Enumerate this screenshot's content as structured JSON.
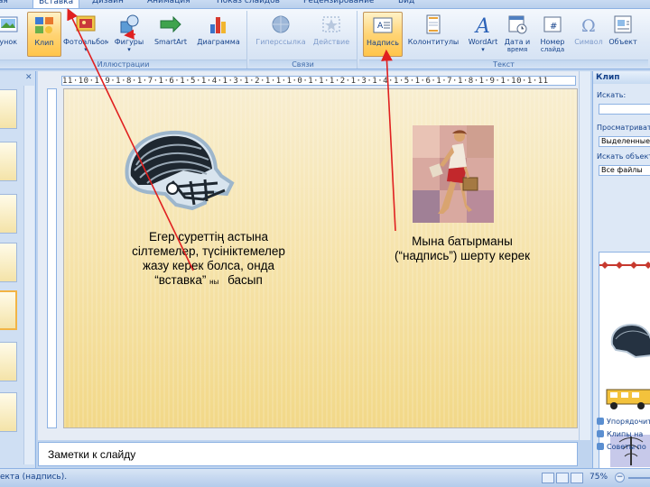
{
  "tabs": [
    {
      "label": "Главная",
      "visible": "ная"
    },
    {
      "label": "Вставка",
      "visible": "Вставка"
    },
    {
      "label": "Дизайн",
      "visible": "Дизайн"
    },
    {
      "label": "Анимация",
      "visible": "Анимация"
    },
    {
      "label": "Показ слайдов",
      "visible": "Показ слайдов"
    },
    {
      "label": "Рецензирование",
      "visible": "Рецензирование"
    },
    {
      "label": "Вид",
      "visible": "Вид"
    }
  ],
  "ribbon": {
    "groups": {
      "illustrations": "Иллюстрации",
      "links": "Связи",
      "text": "Текст"
    },
    "buttons": {
      "picture": "Рисунок",
      "clip": "Клип",
      "photo_album": "Фотоальбом",
      "shapes": "Фигуры",
      "smartart": "SmartArt",
      "chart": "Диаграмма",
      "hyperlink": "Гиперссылка",
      "action": "Действие",
      "text_box": "Надпись",
      "header_footer": "Колонтитулы",
      "wordart": "WordArt",
      "date_time": "Дата и",
      "date_time_2": "время",
      "slide_number": "Номер",
      "slide_number_2": "слайда",
      "symbol": "Символ",
      "object": "Объект"
    }
  },
  "slide": {
    "left_caption_lines": [
      "Егер суреттің астына",
      "сілтемелер, түсініктемелер",
      "жазу керек болса, онда"
    ],
    "left_caption_last_quote": "“вставка”",
    "left_caption_last_small": "ны",
    "left_caption_last_tail": "басып",
    "right_caption_lines": [
      "Мына батырманы",
      "(“надпись”) шерту керек"
    ]
  },
  "ruler_text": "11·10·1·9·1·8·1·7·1·6·1·5·1·4·1·3·1·2·1·1·1·0·1·1·1·2·1·3·1·4·1·5·1·6·1·7·1·8·1·9·1·10·1·11",
  "task_pane": {
    "title": "Клип",
    "search_label": "Искать:",
    "search_in_label": "Просматривать:",
    "search_in_value": "Выделенные",
    "results_label": "Искать объекты:",
    "results_value": "Все файлы",
    "links": [
      "Упорядочить",
      "Клипы на",
      "Советы по"
    ]
  },
  "notes": {
    "placeholder": "Заметки к слайду"
  },
  "status": {
    "left_text": "екта (надпись).",
    "zoom": "75%"
  },
  "colors": {
    "ribbon_blue": "#15428b",
    "active_button": "#ffd475",
    "arrow_red": "#e02020"
  }
}
